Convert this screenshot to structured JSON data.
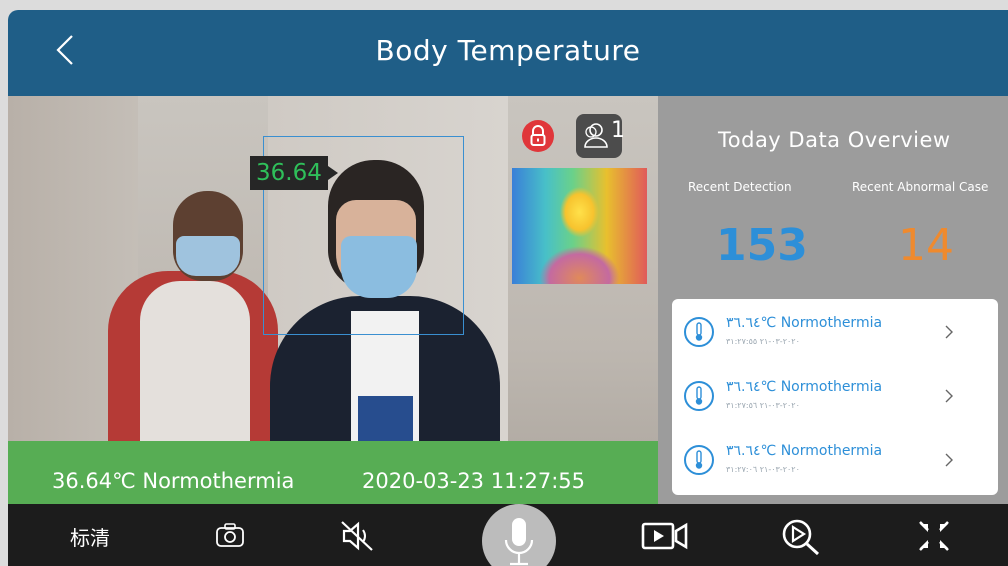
{
  "header": {
    "title": "Body Temperature"
  },
  "camera": {
    "temp_tag": "36.64",
    "people_count": "1",
    "status_temp": "36.64℃ Normothermia",
    "status_time": "2020-03-23 11:27:55"
  },
  "overview": {
    "title": "Today Data Overview",
    "recent_label": "Recent Detection",
    "abnormal_label": "Recent Abnormal Case",
    "recent_value": "153",
    "abnormal_value": "14",
    "records": [
      {
        "temp": "٣٦.٦٤℃ Normothermia",
        "time": "٢٠٢٠-٠٣-٢١ ٣١:٢٧:٥٥"
      },
      {
        "temp": "٣٦.٦٤℃ Normothermia",
        "time": "٢٠٢٠-٠٣-٢١ ٣١:٢٧:٥٦"
      },
      {
        "temp": "٣٦.٦٤℃ Normothermia",
        "time": "٢٠٢٠-٠٣-٢١ ٣١:٢٧:٠٦"
      }
    ]
  },
  "toolbar": {
    "quality_label": "标清"
  },
  "colors": {
    "header": "#1f5e87",
    "status_green": "#57ad54",
    "accent_blue": "#2d8fd8",
    "accent_orange": "#ef8a2e"
  }
}
